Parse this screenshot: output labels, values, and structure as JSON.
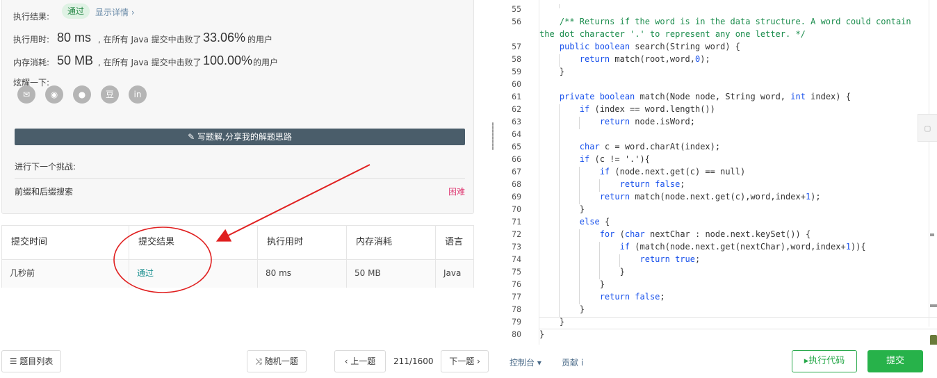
{
  "result": {
    "label": "执行结果:",
    "status": "通过",
    "details_link": "显示详情 ›",
    "runtime_label": "执行用时:",
    "runtime_value": "80 ms",
    "runtime_text": ", 在所有 Java 提交中击败了",
    "runtime_percent": "33.06%",
    "runtime_suffix": "的用户",
    "memory_label": "内存消耗:",
    "memory_value": "50 MB",
    "memory_text": ", 在所有 Java 提交中击败了",
    "memory_percent": "100.00%",
    "memory_suffix": "的用户",
    "share_label": "炫耀一下:",
    "share_icons": [
      {
        "name": "wechat-icon",
        "glyph": "✉"
      },
      {
        "name": "weibo-icon",
        "glyph": "◉"
      },
      {
        "name": "qq-icon",
        "glyph": "●"
      },
      {
        "name": "douban-icon",
        "glyph": "豆"
      },
      {
        "name": "linkedin-icon",
        "glyph": "in"
      }
    ],
    "write_solution": "✎ 写题解,分享我的解题思路",
    "next_challenge_label": "进行下一个挑战:",
    "next_problem": "前缀和后缀搜索",
    "next_difficulty": "困难"
  },
  "submissions": {
    "headers": [
      "提交时间",
      "提交结果",
      "执行用时",
      "内存消耗",
      "语言"
    ],
    "rows": [
      [
        "几秒前",
        "通过",
        "80 ms",
        "50 MB",
        "Java"
      ]
    ]
  },
  "editor": {
    "lines": [
      {
        "n": "55",
        "html": ""
      },
      {
        "n": "56",
        "html": "    <span class='cm'>/** Returns if the word is in the data structure. A word could contain</span>"
      },
      {
        "n": "",
        "html": "<span class='cm'>the dot character '.' to represent any one letter. */</span>",
        "wrap": true
      },
      {
        "n": "57",
        "html": "    <span class='kw'>public boolean</span> search(String word) {"
      },
      {
        "n": "58",
        "html": "        <span class='kw'>return</span> match(root,word,<span class='num'>0</span>);"
      },
      {
        "n": "59",
        "html": "    }"
      },
      {
        "n": "60",
        "html": ""
      },
      {
        "n": "61",
        "html": "    <span class='kw'>private boolean</span> match(Node node, String word, <span class='kw'>int</span> index) {"
      },
      {
        "n": "62",
        "html": "        <span class='kw'>if</span> (index == word.length())"
      },
      {
        "n": "63",
        "html": "            <span class='kw'>return</span> node.isWord;"
      },
      {
        "n": "64",
        "html": ""
      },
      {
        "n": "65",
        "html": "        <span class='kw'>char</span> c = word.charAt(index);"
      },
      {
        "n": "66",
        "html": "        <span class='kw'>if</span> (c != '.'){"
      },
      {
        "n": "67",
        "html": "            <span class='kw'>if</span> (node.next.get(c) == null)"
      },
      {
        "n": "68",
        "html": "                <span class='kw'>return false</span>;"
      },
      {
        "n": "69",
        "html": "            <span class='kw'>return</span> match(node.next.get(c),word,index+<span class='num'>1</span>);"
      },
      {
        "n": "70",
        "html": "        }"
      },
      {
        "n": "71",
        "html": "        <span class='kw'>else</span> {"
      },
      {
        "n": "72",
        "html": "            <span class='kw'>for</span> (<span class='kw'>char</span> nextChar : node.next.keySet()) {"
      },
      {
        "n": "73",
        "html": "                <span class='kw'>if</span> (match(node.next.get(nextChar),word,index+<span class='num'>1</span>)){"
      },
      {
        "n": "74",
        "html": "                    <span class='kw'>return true</span>;"
      },
      {
        "n": "75",
        "html": "                }"
      },
      {
        "n": "76",
        "html": "            }"
      },
      {
        "n": "77",
        "html": "            <span class='kw'>return false</span>;"
      },
      {
        "n": "78",
        "html": "        }"
      },
      {
        "n": "79",
        "html": "    }"
      },
      {
        "n": "80",
        "html": "}"
      }
    ]
  },
  "bottom_bar": {
    "problem_list": "☰ 题目列表",
    "random": "⤨ 随机一题",
    "prev": "‹ 上一题",
    "counter": "211/1600",
    "next": "下一题 ›",
    "console": "控制台 ▾",
    "contribute": "贡献 i",
    "run_code": "▸执行代码",
    "submit": "提交"
  },
  "colors": {
    "accent_green": "#27b24a",
    "pass_teal": "#1a8f8f",
    "difficulty_red": "#e0457b",
    "annotation_red": "#e02020"
  }
}
